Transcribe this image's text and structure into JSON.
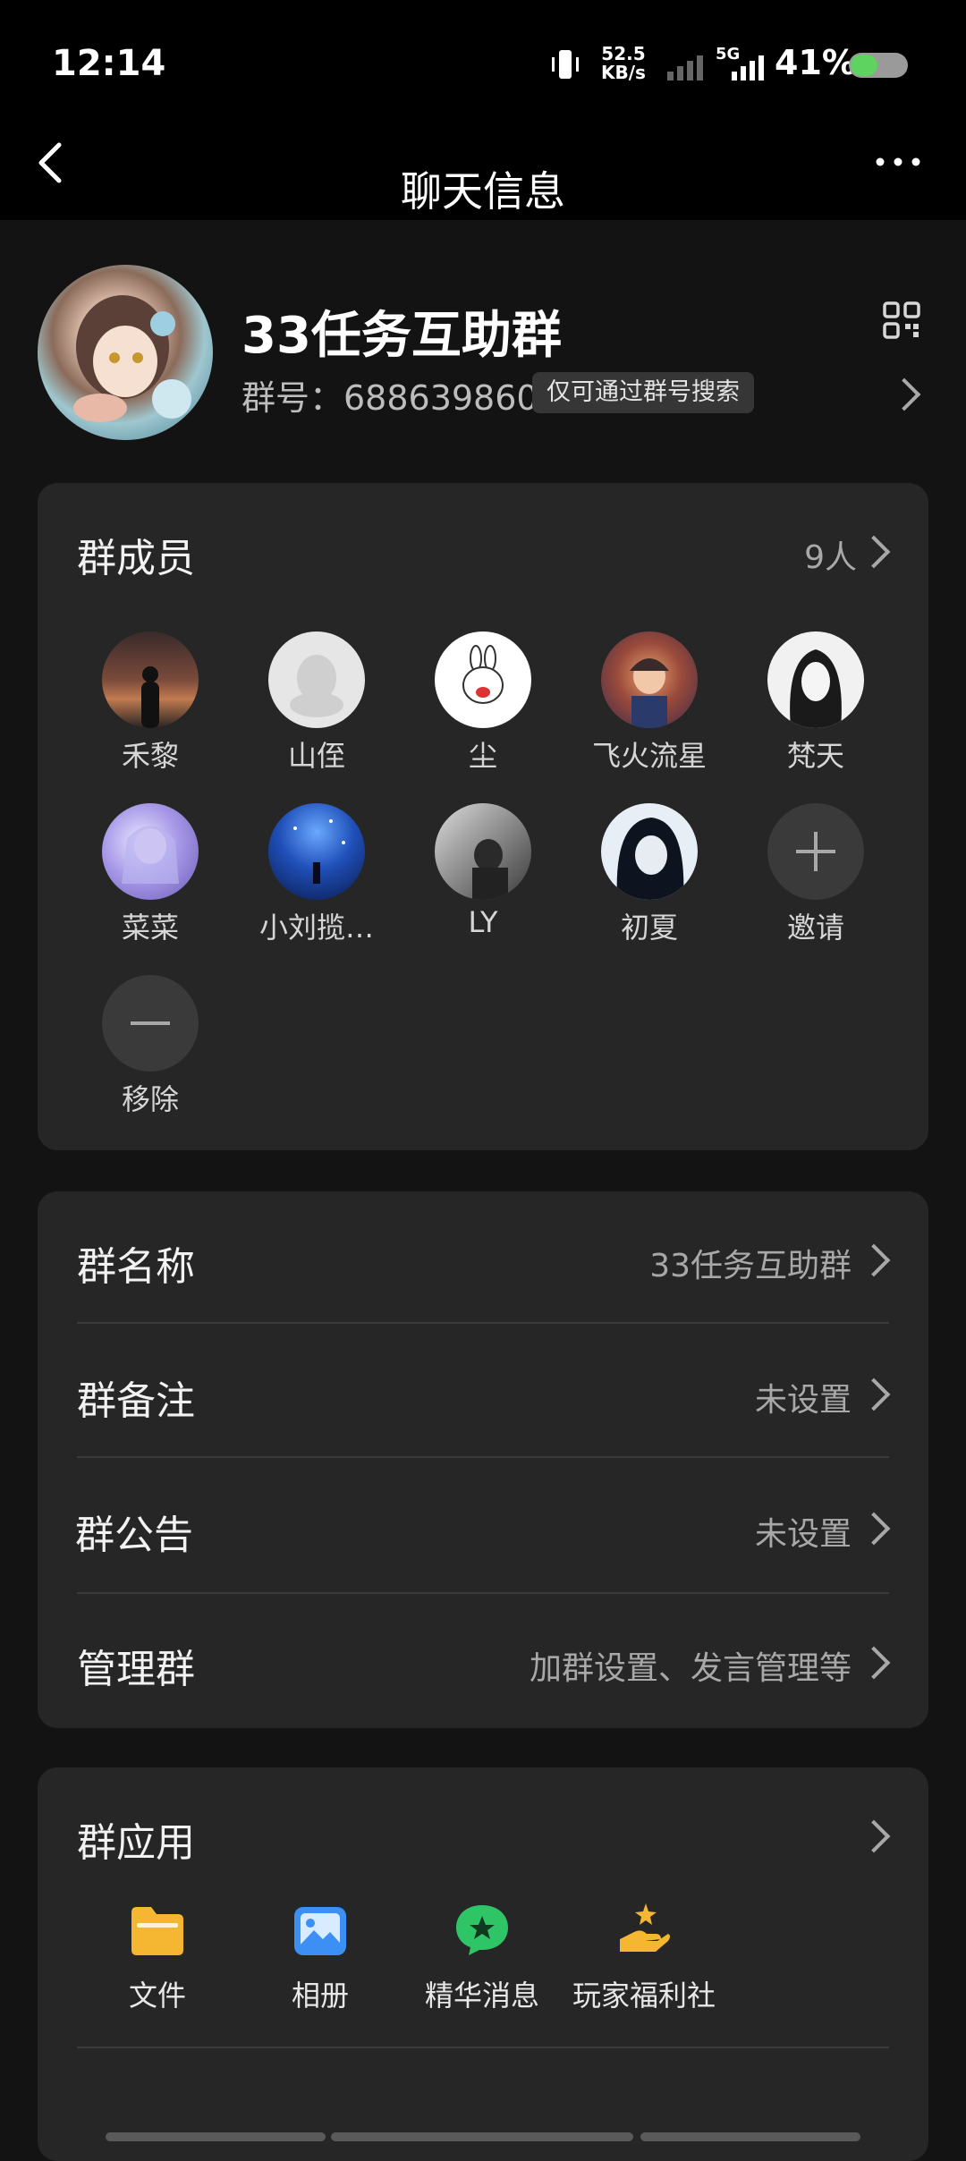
{
  "status": {
    "time": "12:14",
    "net_speed_value": "52.5",
    "net_speed_unit": "KB/s",
    "network": "5G",
    "battery": "41%"
  },
  "nav": {
    "title": "聊天信息"
  },
  "group": {
    "name": "33任务互助群",
    "id_line": "群号：688639860",
    "search_badge": "仅可通过群号搜索"
  },
  "members": {
    "label": "群成员",
    "count": "9人",
    "items": [
      {
        "name": "禾黎"
      },
      {
        "name": "山侄"
      },
      {
        "name": "尘"
      },
      {
        "name": "飞火流星"
      },
      {
        "name": "梵天"
      },
      {
        "name": "菜菜"
      },
      {
        "name": "小刘揽…"
      },
      {
        "name": "LY"
      },
      {
        "name": "初夏"
      }
    ],
    "invite_label": "邀请",
    "remove_label": "移除"
  },
  "settings": {
    "rows": [
      {
        "label": "群名称",
        "value": "33任务互助群"
      },
      {
        "label": "群备注",
        "value": "未设置"
      },
      {
        "label": "群公告",
        "value": "未设置"
      },
      {
        "label": "管理群",
        "value": "加群设置、发言管理等"
      }
    ]
  },
  "apps": {
    "label": "群应用",
    "items": [
      {
        "label": "文件",
        "icon": "folder-icon",
        "color": "#f5b731"
      },
      {
        "label": "相册",
        "icon": "album-icon",
        "color": "#3b8ff5"
      },
      {
        "label": "精华消息",
        "icon": "essence-icon",
        "color": "#2fc566"
      },
      {
        "label": "玩家福利社",
        "icon": "gift-hand-icon",
        "color": "#f5b731"
      }
    ]
  }
}
